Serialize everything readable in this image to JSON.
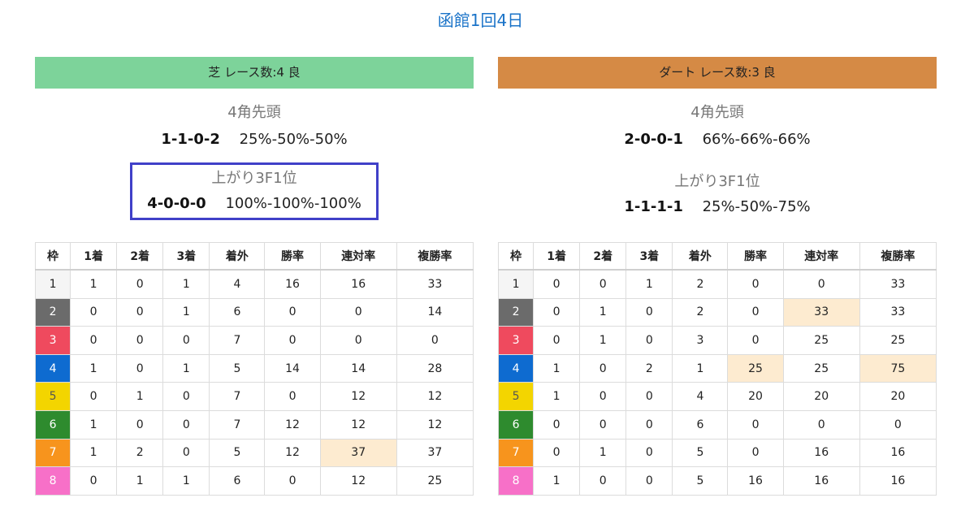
{
  "page_title": "函館1回4日",
  "columns": [
    "枠",
    "1着",
    "2着",
    "3着",
    "着外",
    "勝率",
    "連対率",
    "複勝率"
  ],
  "waku_colors": {
    "1": {
      "bg": "#f5f5f5",
      "fg": "#222222"
    },
    "2": {
      "bg": "#6b6b6b",
      "fg": "#ffffff"
    },
    "3": {
      "bg": "#ef4a5e",
      "fg": "#ffffff"
    },
    "4": {
      "bg": "#0e6bd0",
      "fg": "#ffffff"
    },
    "5": {
      "bg": "#f3d500",
      "fg": "#555555"
    },
    "6": {
      "bg": "#2e8b2e",
      "fg": "#ffffff"
    },
    "7": {
      "bg": "#f7941d",
      "fg": "#ffffff"
    },
    "8": {
      "bg": "#f770c8",
      "fg": "#ffffff"
    }
  },
  "highlight_color": "#fdebd0",
  "turf": {
    "header": "芝 レース数:4  良",
    "header_color": "#7dd39a",
    "front4": {
      "label": "4角先頭",
      "record": "1-1-0-2",
      "rates": "25%-50%-50%"
    },
    "last3f": {
      "label": "上がり3F1位",
      "record": "4-0-0-0",
      "rates": "100%-100%-100%"
    },
    "rows": [
      {
        "waku": "1",
        "c1": "1",
        "c2": "0",
        "c3": "1",
        "out": "4",
        "win": "16",
        "ren": "16",
        "fuku": "33",
        "hi": []
      },
      {
        "waku": "2",
        "c1": "0",
        "c2": "0",
        "c3": "1",
        "out": "6",
        "win": "0",
        "ren": "0",
        "fuku": "14",
        "hi": []
      },
      {
        "waku": "3",
        "c1": "0",
        "c2": "0",
        "c3": "0",
        "out": "7",
        "win": "0",
        "ren": "0",
        "fuku": "0",
        "hi": []
      },
      {
        "waku": "4",
        "c1": "1",
        "c2": "0",
        "c3": "1",
        "out": "5",
        "win": "14",
        "ren": "14",
        "fuku": "28",
        "hi": []
      },
      {
        "waku": "5",
        "c1": "0",
        "c2": "1",
        "c3": "0",
        "out": "7",
        "win": "0",
        "ren": "12",
        "fuku": "12",
        "hi": []
      },
      {
        "waku": "6",
        "c1": "1",
        "c2": "0",
        "c3": "0",
        "out": "7",
        "win": "12",
        "ren": "12",
        "fuku": "12",
        "hi": []
      },
      {
        "waku": "7",
        "c1": "1",
        "c2": "2",
        "c3": "0",
        "out": "5",
        "win": "12",
        "ren": "37",
        "fuku": "37",
        "hi": [
          "ren"
        ]
      },
      {
        "waku": "8",
        "c1": "0",
        "c2": "1",
        "c3": "1",
        "out": "6",
        "win": "0",
        "ren": "12",
        "fuku": "25",
        "hi": []
      }
    ]
  },
  "dirt": {
    "header": "ダート レース数:3  良",
    "header_color": "#d58a45",
    "front4": {
      "label": "4角先頭",
      "record": "2-0-0-1",
      "rates": "66%-66%-66%"
    },
    "last3f": {
      "label": "上がり3F1位",
      "record": "1-1-1-1",
      "rates": "25%-50%-75%"
    },
    "rows": [
      {
        "waku": "1",
        "c1": "0",
        "c2": "0",
        "c3": "1",
        "out": "2",
        "win": "0",
        "ren": "0",
        "fuku": "33",
        "hi": []
      },
      {
        "waku": "2",
        "c1": "0",
        "c2": "1",
        "c3": "0",
        "out": "2",
        "win": "0",
        "ren": "33",
        "fuku": "33",
        "hi": [
          "ren"
        ]
      },
      {
        "waku": "3",
        "c1": "0",
        "c2": "1",
        "c3": "0",
        "out": "3",
        "win": "0",
        "ren": "25",
        "fuku": "25",
        "hi": []
      },
      {
        "waku": "4",
        "c1": "1",
        "c2": "0",
        "c3": "2",
        "out": "1",
        "win": "25",
        "ren": "25",
        "fuku": "75",
        "hi": [
          "win",
          "fuku"
        ]
      },
      {
        "waku": "5",
        "c1": "1",
        "c2": "0",
        "c3": "0",
        "out": "4",
        "win": "20",
        "ren": "20",
        "fuku": "20",
        "hi": []
      },
      {
        "waku": "6",
        "c1": "0",
        "c2": "0",
        "c3": "0",
        "out": "6",
        "win": "0",
        "ren": "0",
        "fuku": "0",
        "hi": []
      },
      {
        "waku": "7",
        "c1": "0",
        "c2": "1",
        "c3": "0",
        "out": "5",
        "win": "0",
        "ren": "16",
        "fuku": "16",
        "hi": []
      },
      {
        "waku": "8",
        "c1": "1",
        "c2": "0",
        "c3": "0",
        "out": "5",
        "win": "16",
        "ren": "16",
        "fuku": "16",
        "hi": []
      }
    ]
  }
}
